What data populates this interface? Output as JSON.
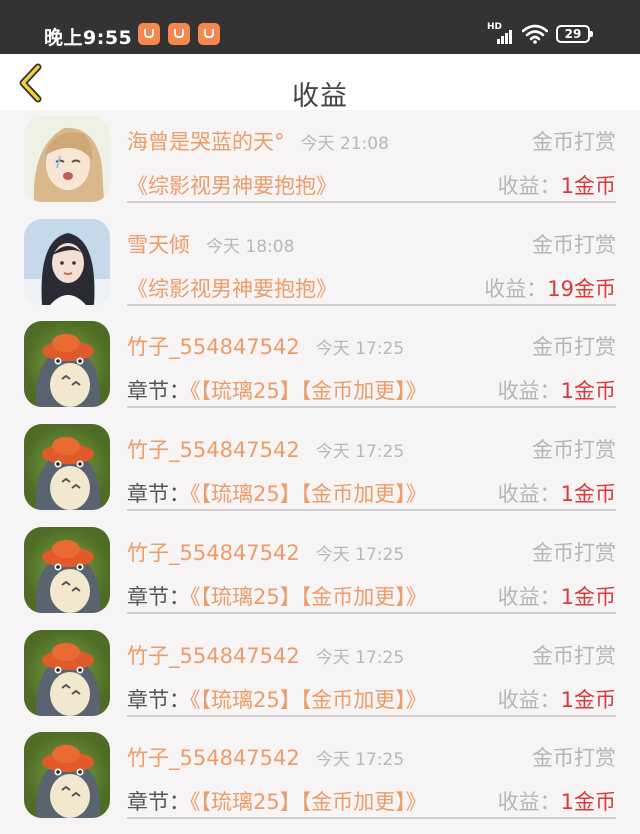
{
  "status_bar": {
    "time": "晚上9:55",
    "network": "HD",
    "battery": "29",
    "notification_icons": [
      "taobao-icon",
      "taobao-icon",
      "taobao-icon"
    ]
  },
  "nav": {
    "title": "收益",
    "back_icon": "chevron-left-icon"
  },
  "colors": {
    "accent_orange": "#ec9d6a",
    "amount_red": "#d83a3a",
    "gray_text": "#b6b6b6",
    "status_bar_bg": "#333333"
  },
  "records": [
    {
      "avatar": "anime-girl-avatar",
      "name": "海曾是哭蓝的天°",
      "time": "今天 21:08",
      "type": "金币打赏",
      "prefix": "",
      "book": "《综影视男神要抱抱》",
      "income_label": "收益：",
      "amount": "1金币"
    },
    {
      "avatar": "photo-girl-avatar",
      "name": "雪天倾",
      "time": "今天 18:08",
      "type": "金币打赏",
      "prefix": "",
      "book": "《综影视男神要抱抱》",
      "income_label": "收益：",
      "amount": "19金币"
    },
    {
      "avatar": "totoro-avatar",
      "name": "竹子_554847542",
      "time": "今天 17:25",
      "type": "金币打赏",
      "prefix": "章节：",
      "book": "《【琉璃25】【金币加更】》",
      "income_label": "收益：",
      "amount": "1金币"
    },
    {
      "avatar": "totoro-avatar",
      "name": "竹子_554847542",
      "time": "今天 17:25",
      "type": "金币打赏",
      "prefix": "章节：",
      "book": "《【琉璃25】【金币加更】》",
      "income_label": "收益：",
      "amount": "1金币"
    },
    {
      "avatar": "totoro-avatar",
      "name": "竹子_554847542",
      "time": "今天 17:25",
      "type": "金币打赏",
      "prefix": "章节：",
      "book": "《【琉璃25】【金币加更】》",
      "income_label": "收益：",
      "amount": "1金币"
    },
    {
      "avatar": "totoro-avatar",
      "name": "竹子_554847542",
      "time": "今天 17:25",
      "type": "金币打赏",
      "prefix": "章节：",
      "book": "《【琉璃25】【金币加更】》",
      "income_label": "收益：",
      "amount": "1金币"
    },
    {
      "avatar": "totoro-avatar",
      "name": "竹子_554847542",
      "time": "今天 17:25",
      "type": "金币打赏",
      "prefix": "章节：",
      "book": "《【琉璃25】【金币加更】》",
      "income_label": "收益：",
      "amount": "1金币"
    }
  ]
}
